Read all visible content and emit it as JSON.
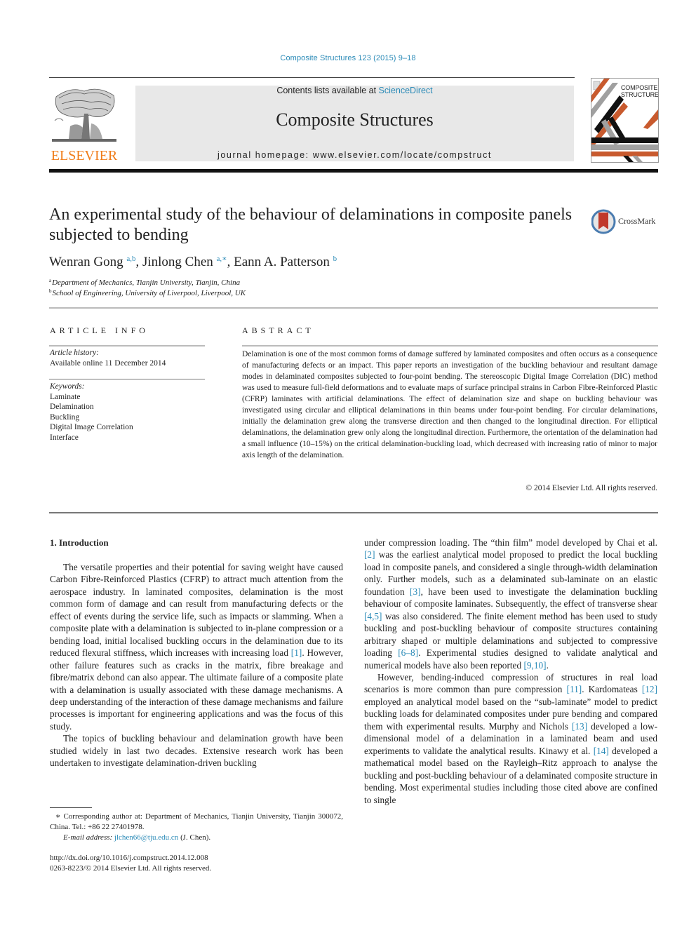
{
  "header": {
    "journal_ref": "Composite Structures 123 (2015) 9–18",
    "contents_prefix": "Contents lists available at ",
    "contents_link": "ScienceDirect",
    "journal_title": "Composite Structures",
    "homepage_prefix": "journal homepage: ",
    "homepage_url": "www.elsevier.com/locate/compstruct",
    "publisher_logo_text": "ELSEVIER",
    "cover_title_line1": "COMPOSITE",
    "cover_title_line2": "STRUCTURES"
  },
  "colors": {
    "link": "#2a8ab7",
    "elsevier_orange": "#f07d1a",
    "banner_bg": "#e8e8e8",
    "cover_orange": "#c85a2e",
    "cover_grey": "#a0a0a0",
    "cover_black": "#111111",
    "crossmark_red": "#c0392b",
    "crossmark_blue": "#4a7cb0"
  },
  "article": {
    "title": "An experimental study of the behaviour of delaminations in composite panels subjected to bending",
    "crossmark_label": "CrossMark",
    "authors": [
      {
        "name": "Wenran Gong",
        "sup": "a,b",
        "sep": ", "
      },
      {
        "name": "Jinlong Chen",
        "sup": "a,∗",
        "sep": ", "
      },
      {
        "name": "Eann A. Patterson",
        "sup": "b",
        "sep": ""
      }
    ],
    "affiliations": [
      {
        "key": "a",
        "text": "Department of Mechanics, Tianjin University, Tianjin, China"
      },
      {
        "key": "b",
        "text": "School of Engineering, University of Liverpool, Liverpool, UK"
      }
    ]
  },
  "article_info": {
    "heading": "ARTICLE INFO",
    "history_label": "Article history:",
    "history_value": "Available online 11 December 2014",
    "keywords_label": "Keywords:",
    "keywords": [
      "Laminate",
      "Delamination",
      "Buckling",
      "Digital Image Correlation",
      "Interface"
    ]
  },
  "abstract": {
    "heading": "ABSTRACT",
    "text": "Delamination is one of the most common forms of damage suffered by laminated composites and often occurs as a consequence of manufacturing defects or an impact. This paper reports an investigation of the buckling behaviour and resultant damage modes in delaminated composites subjected to four-point bending. The stereoscopic Digital Image Correlation (DIC) method was used to measure full-field deformations and to evaluate maps of surface principal strains in Carbon Fibre-Reinforced Plastic (CFRP) laminates with artificial delaminations. The effect of delamination size and shape on buckling behaviour was investigated using circular and elliptical delaminations in thin beams under four-point bending. For circular delaminations, initially the delamination grew along the transverse direction and then changed to the longitudinal direction. For elliptical delaminations, the delamination grew only along the longitudinal direction. Furthermore, the orientation of the delamination had a small influence (10–15%) on the critical delamination-buckling load, which decreased with increasing ratio of minor to major axis length of the delamination.",
    "copyright": "© 2014 Elsevier Ltd. All rights reserved."
  },
  "body": {
    "section_heading": "1. Introduction",
    "left_p1": [
      {
        "t": "The versatile properties and their potential for saving weight have caused Carbon Fibre-Reinforced Plastics (CFRP) to attract much attention from the aerospace industry. In laminated composites, delamination is the most common form of damage and can result from manufacturing defects or the effect of events during the service life, such as impacts or slamming. When a composite plate with a delamination is subjected to in-plane compression or a bending load, initial localised buckling occurs in the delamination due to its reduced flexural stiffness, which increases with increasing load "
      },
      {
        "ref": "[1]"
      },
      {
        "t": ". However, other failure features such as cracks in the matrix, fibre breakage and fibre/matrix debond can also appear. The ultimate failure of a composite plate with a delamination is usually associated with these damage mechanisms. A deep understanding of the interaction of these damage mechanisms and failure processes is important for engineering applications and was the focus of this study."
      }
    ],
    "left_p2": "The topics of buckling behaviour and delamination growth have been studied widely in last two decades. Extensive research work has been undertaken to investigate delamination-driven buckling",
    "right_p1": [
      {
        "t": "under compression loading. The “thin film” model developed by Chai et al. "
      },
      {
        "ref": "[2]"
      },
      {
        "t": " was the earliest analytical model proposed to predict the local buckling load in composite panels, and considered a single through-width delamination only. Further models, such as a delaminated sub-laminate on an elastic foundation "
      },
      {
        "ref": "[3]"
      },
      {
        "t": ", have been used to investigate the delamination buckling behaviour of composite laminates. Subsequently, the effect of transverse shear "
      },
      {
        "ref": "[4,5]"
      },
      {
        "t": " was also considered. The finite element method has been used to study buckling and post-buckling behaviour of composite structures containing arbitrary shaped or multiple delaminations and subjected to compressive loading "
      },
      {
        "ref": "[6–8]"
      },
      {
        "t": ". Experimental studies designed to validate analytical and numerical models have also been reported "
      },
      {
        "ref": "[9,10]"
      },
      {
        "t": "."
      }
    ],
    "right_p2": [
      {
        "t": "However, bending-induced compression of structures in real load scenarios is more common than pure compression "
      },
      {
        "ref": "[11]"
      },
      {
        "t": ". Kardomateas "
      },
      {
        "ref": "[12]"
      },
      {
        "t": " employed an analytical model based on the “sub-laminate” model to predict buckling loads for delaminated composites under pure bending and compared them with experimental results. Murphy and Nichols "
      },
      {
        "ref": "[13]"
      },
      {
        "t": " developed a low-dimensional model of a delamination in a laminated beam and used experiments to validate the analytical results. Kinawy et al. "
      },
      {
        "ref": "[14]"
      },
      {
        "t": " developed a mathematical model based on the Rayleigh–Ritz approach to analyse the buckling and post-buckling behaviour of a delaminated composite structure in bending. Most experimental studies including those cited above are confined to single"
      }
    ]
  },
  "footnote": {
    "corresponding": "∗ Corresponding author at: Department of Mechanics, Tianjin University, Tianjin 300072, China. Tel.: +86 22 27401978.",
    "email_label": "E-mail address: ",
    "email": "jlchen66@tju.edu.cn",
    "email_suffix": " (J. Chen).",
    "doi": "http://dx.doi.org/10.1016/j.compstruct.2014.12.008",
    "issn_copyright": "0263-8223/© 2014 Elsevier Ltd. All rights reserved."
  }
}
